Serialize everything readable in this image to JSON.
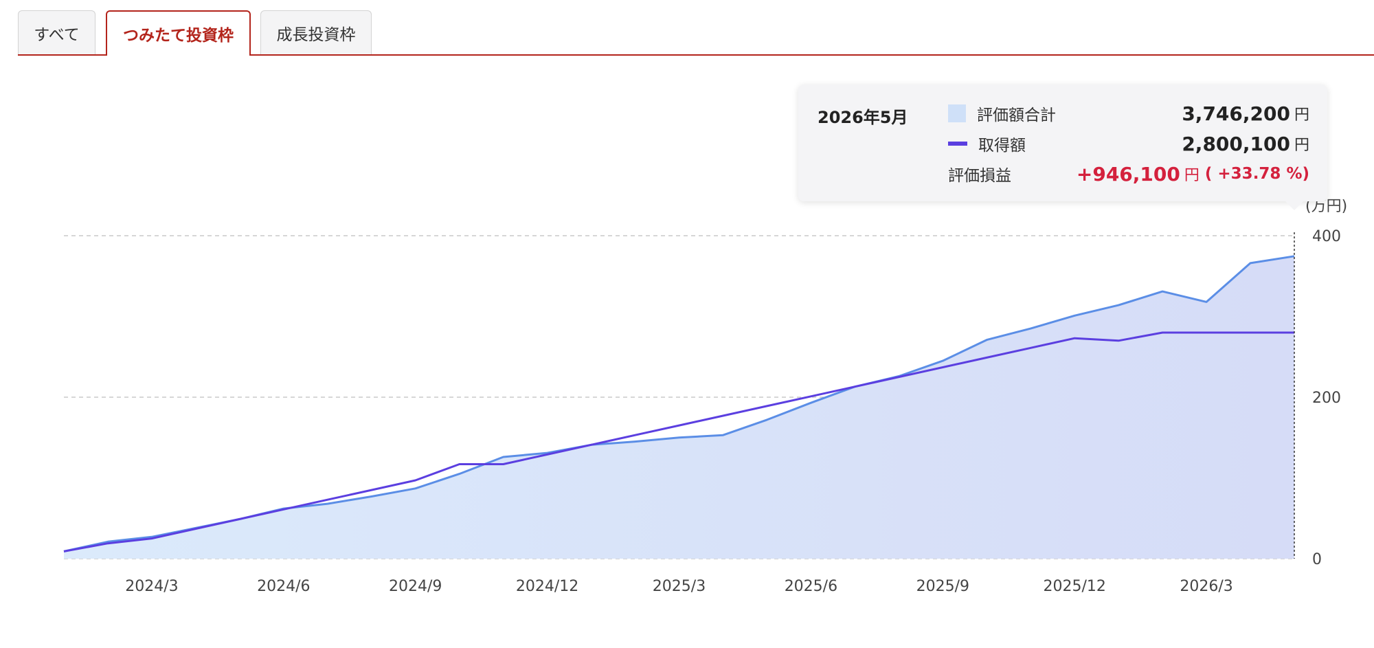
{
  "tabs": [
    {
      "label": "すべて",
      "active": false
    },
    {
      "label": "つみたて投資枠",
      "active": true
    },
    {
      "label": "成長投資枠",
      "active": false
    }
  ],
  "colors": {
    "accent": "#b3241b",
    "area_stroke": "#5b8ee6",
    "line": "#5b3fe0",
    "gain": "#d4213d"
  },
  "tooltip": {
    "date": "2026年5月",
    "rows": [
      {
        "label": "評価額合計",
        "value": "3,746,200",
        "unit": "円"
      },
      {
        "label": "取得額",
        "value": "2,800,100",
        "unit": "円"
      }
    ],
    "gain_label": "評価損益",
    "gain_value": "+946,100",
    "gain_unit": "円",
    "gain_pct": "( +33.78 %)"
  },
  "chart_data": {
    "type": "area",
    "y_unit_label": "(万円)",
    "ylim": [
      0,
      400
    ],
    "yticks": [
      0,
      200,
      400
    ],
    "xticks": [
      "2024/3",
      "2024/6",
      "2024/9",
      "2024/12",
      "2025/3",
      "2025/6",
      "2025/9",
      "2025/12",
      "2026/3"
    ],
    "x": [
      "2024/1",
      "2024/2",
      "2024/3",
      "2024/4",
      "2024/5",
      "2024/6",
      "2024/7",
      "2024/8",
      "2024/9",
      "2024/10",
      "2024/11",
      "2024/12",
      "2025/1",
      "2025/2",
      "2025/3",
      "2025/4",
      "2025/5",
      "2025/6",
      "2025/7",
      "2025/8",
      "2025/9",
      "2025/10",
      "2025/11",
      "2025/12",
      "2026/1",
      "2026/2",
      "2026/3",
      "2026/4",
      "2026/5"
    ],
    "grid": true,
    "series": [
      {
        "name": "評価額合計",
        "kind": "area",
        "values": [
          9,
          21,
          27,
          38,
          49,
          62,
          68,
          77,
          87,
          105,
          126,
          131,
          141,
          145,
          150,
          153,
          172,
          193,
          213,
          226,
          245,
          271,
          285,
          301,
          314,
          331,
          318,
          366,
          374.62
        ]
      },
      {
        "name": "取得額",
        "kind": "line",
        "values": [
          9,
          19,
          25,
          37,
          49,
          61,
          73,
          85,
          97,
          117,
          117,
          129,
          141,
          153,
          165,
          177,
          189,
          201,
          213,
          225,
          237,
          249,
          261,
          273,
          270,
          280,
          280,
          280,
          280.01
        ]
      }
    ]
  }
}
